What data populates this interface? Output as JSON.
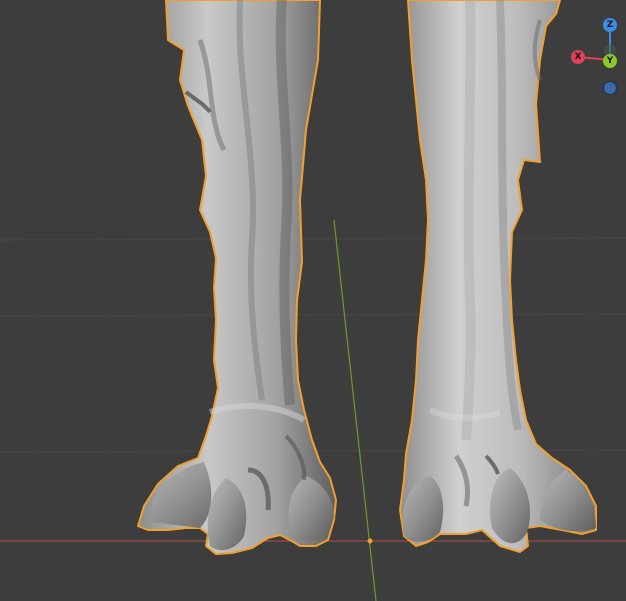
{
  "viewport": {
    "background": "#3d3d3d",
    "grid_color": "#474747",
    "axis_x_color": "#b34a4a",
    "axis_y_color": "#6b9a2a",
    "selection_outline_color": "#f0a030",
    "origin_color": "#f0a030"
  },
  "gizmo": {
    "x_axis": {
      "label": "X",
      "color": "#e0405a"
    },
    "y_axis": {
      "label": "Y",
      "color": "#8ac92a"
    },
    "z_axis": {
      "label": "Z",
      "color": "#3a8ee6"
    },
    "neg_z_axis": {
      "color": "#3a6aa8"
    }
  }
}
